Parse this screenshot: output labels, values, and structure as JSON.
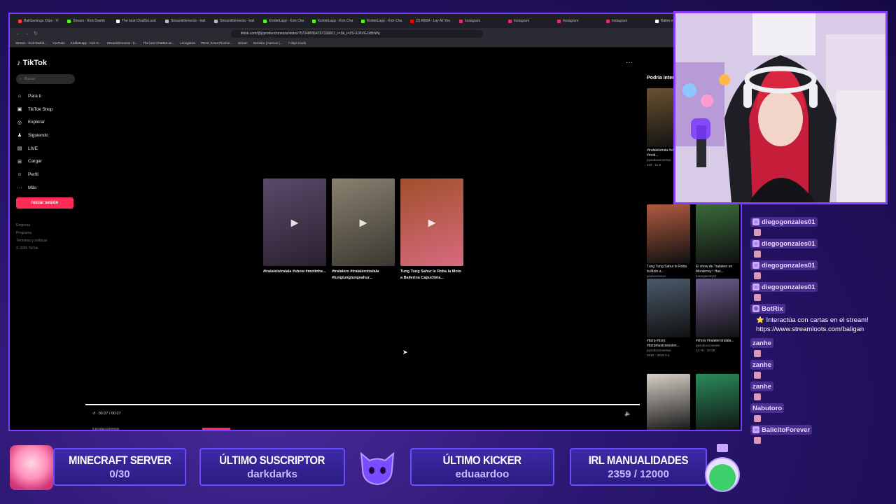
{
  "browser": {
    "tabs": [
      {
        "label": "BaliGamings Clips - Yi",
        "color": "#ff3b3b"
      },
      {
        "label": "Stream - Kick Dashb",
        "color": "#53fc18"
      },
      {
        "label": "The best ChatBot and",
        "color": "#ffffff"
      },
      {
        "label": "StreamElements - bali",
        "color": "#bbbbbb"
      },
      {
        "label": "StreamElements - bali",
        "color": "#bbbbbb"
      },
      {
        "label": "KickletLapp - Kick Cha",
        "color": "#53fc18"
      },
      {
        "label": "KickletLapp - Kick Cha",
        "color": "#53fc18"
      },
      {
        "label": "KickletLapp - Kick Cha",
        "color": "#53fc18"
      },
      {
        "label": "(2) ABBA - Lay All You",
        "color": "#ff0000"
      },
      {
        "label": "Instagram",
        "color": "#e1306c"
      },
      {
        "label": "Instagram",
        "color": "#e1306c"
      },
      {
        "label": "Instagram",
        "color": "#e1306c"
      },
      {
        "label": "Instagram",
        "color": "#e1306c"
      },
      {
        "label": "Bailes e Shows: A",
        "color": "#ffffff"
      }
    ],
    "url": "tiktok.com/@jcproduccionesss/video/7572480364797330007_r=1&_t=ZS-91RVGZd5hWq",
    "bookmarks": [
      "Stream - Kick Dashb...",
      "YouTube",
      "KickletLapp - Kick C...",
      "StreamElements - b...",
      "The best ChatBot an...",
      "Leosganes",
      "PEAK Scout Plushie...",
      "stream",
      "Servidor | Aternos |...",
      "7 days mods"
    ]
  },
  "tiktok": {
    "logo": "TikTok",
    "search_placeholder": "Buscar",
    "nav": [
      {
        "icon": "home-icon",
        "glyph": "⌂",
        "label": "Para ti"
      },
      {
        "icon": "shop-icon",
        "glyph": "▣",
        "label": "TikTok Shop"
      },
      {
        "icon": "compass-icon",
        "glyph": "◎",
        "label": "Explorar"
      },
      {
        "icon": "following-icon",
        "glyph": "♟",
        "label": "Siguiendo"
      },
      {
        "icon": "live-icon",
        "glyph": "▤",
        "label": "LIVE"
      },
      {
        "icon": "upload-icon",
        "glyph": "⊞",
        "label": "Cargar"
      },
      {
        "icon": "profile-icon",
        "glyph": "☺",
        "label": "Perfil"
      },
      {
        "icon": "more-icon",
        "glyph": "···",
        "label": "Más"
      }
    ],
    "login_label": "Iniciar sesión",
    "footer": [
      "Empresa",
      "Programa",
      "Términos y políticas",
      "© 2025 TikTok"
    ],
    "videos": [
      {
        "caption": "#tralalelotralala #show #motinha...",
        "color_a": "#5a4a6a",
        "color_b": "#2a2030"
      },
      {
        "caption": "#tralalero #tralalerotralala #tungtungtungsahur...",
        "color_a": "#8a8070",
        "color_b": "#3a3830"
      },
      {
        "caption": "Tung Tung Sahur le Roba la Moto a Ballerina Capuchina...",
        "color_a": "#a0502a",
        "color_b": "#d86a80"
      }
    ],
    "time": "00:27 / 00:27",
    "progress": 1.0,
    "author": "jcproduccionesss",
    "recommended_title": "Podría interesarte",
    "recommended": [
      {
        "caption": "#tralalelotrala #show #moti...",
        "meta1": "jcproduccionesss",
        "meta2": "318 · 11-5",
        "color": "#6a5030"
      },
      {
        "caption": "Tung Tung Sahur le Roba la Moto a...",
        "meta1": "ginduverseoo",
        "meta2": "23.8K · 9-30",
        "color": "#b05a40"
      },
      {
        "caption": "El show de Tralalero en Monterrey ! Has...",
        "meta1": "botargasmtyrd",
        "meta2": "854.8K · 8-3",
        "color": "#3a6a3a"
      },
      {
        "caption": "#bzrp #bzrp #bzrpmusicsession...",
        "meta1": "jcproduccionesss",
        "meta2": "291K · 2024-2-4",
        "color": "#4a5a6a"
      },
      {
        "caption": "#show #tralalerotralala...",
        "meta1": "jcproduccionesss",
        "meta2": "12.7K · 10-28",
        "color": "#6a5a8a"
      },
      {
        "caption": "",
        "meta1": "",
        "meta2": "",
        "color": "#d8d0c8"
      },
      {
        "caption": "",
        "meta1": "",
        "meta2": "",
        "color": "#2a8a5a"
      }
    ]
  },
  "chat": [
    {
      "user": "diegogonzales01",
      "badge": "☺",
      "message": ""
    },
    {
      "user": "diegogonzales01",
      "badge": "☺",
      "message": ""
    },
    {
      "user": "diegogonzales01",
      "badge": "☺",
      "message": ""
    },
    {
      "user": "diegogonzales01",
      "badge": "☺",
      "message": ""
    },
    {
      "user": "BotRix",
      "badge": "⚙",
      "message": "⭐ Interactúa con cartas en el stream! https://www.streamloots.com/baligan"
    },
    {
      "user": "zanhe",
      "badge": "",
      "message": ""
    },
    {
      "user": "zanhe",
      "badge": "",
      "message": ""
    },
    {
      "user": "zanhe",
      "badge": "",
      "message": ""
    },
    {
      "user": "Nabutoro",
      "badge": "",
      "message": ""
    },
    {
      "user": "BalicitoForever",
      "badge": "☺",
      "message": ""
    }
  ],
  "overlay": {
    "minecraft": {
      "title": "MINECRAFT SERVER",
      "value": "0/30"
    },
    "suscriptor": {
      "title": "ÚLTIMO SUSCRIPTOR",
      "value": "darkdarks"
    },
    "kicker": {
      "title": "ÚLTIMO KICKER",
      "value": "eduaardoo"
    },
    "irl": {
      "title": "IRL MANUALIDADES",
      "value": "2359 / 12000"
    }
  },
  "colors": {
    "accent": "#7a3cff",
    "tiktok_red": "#fe2c55",
    "panel": "#3c2aa8"
  }
}
